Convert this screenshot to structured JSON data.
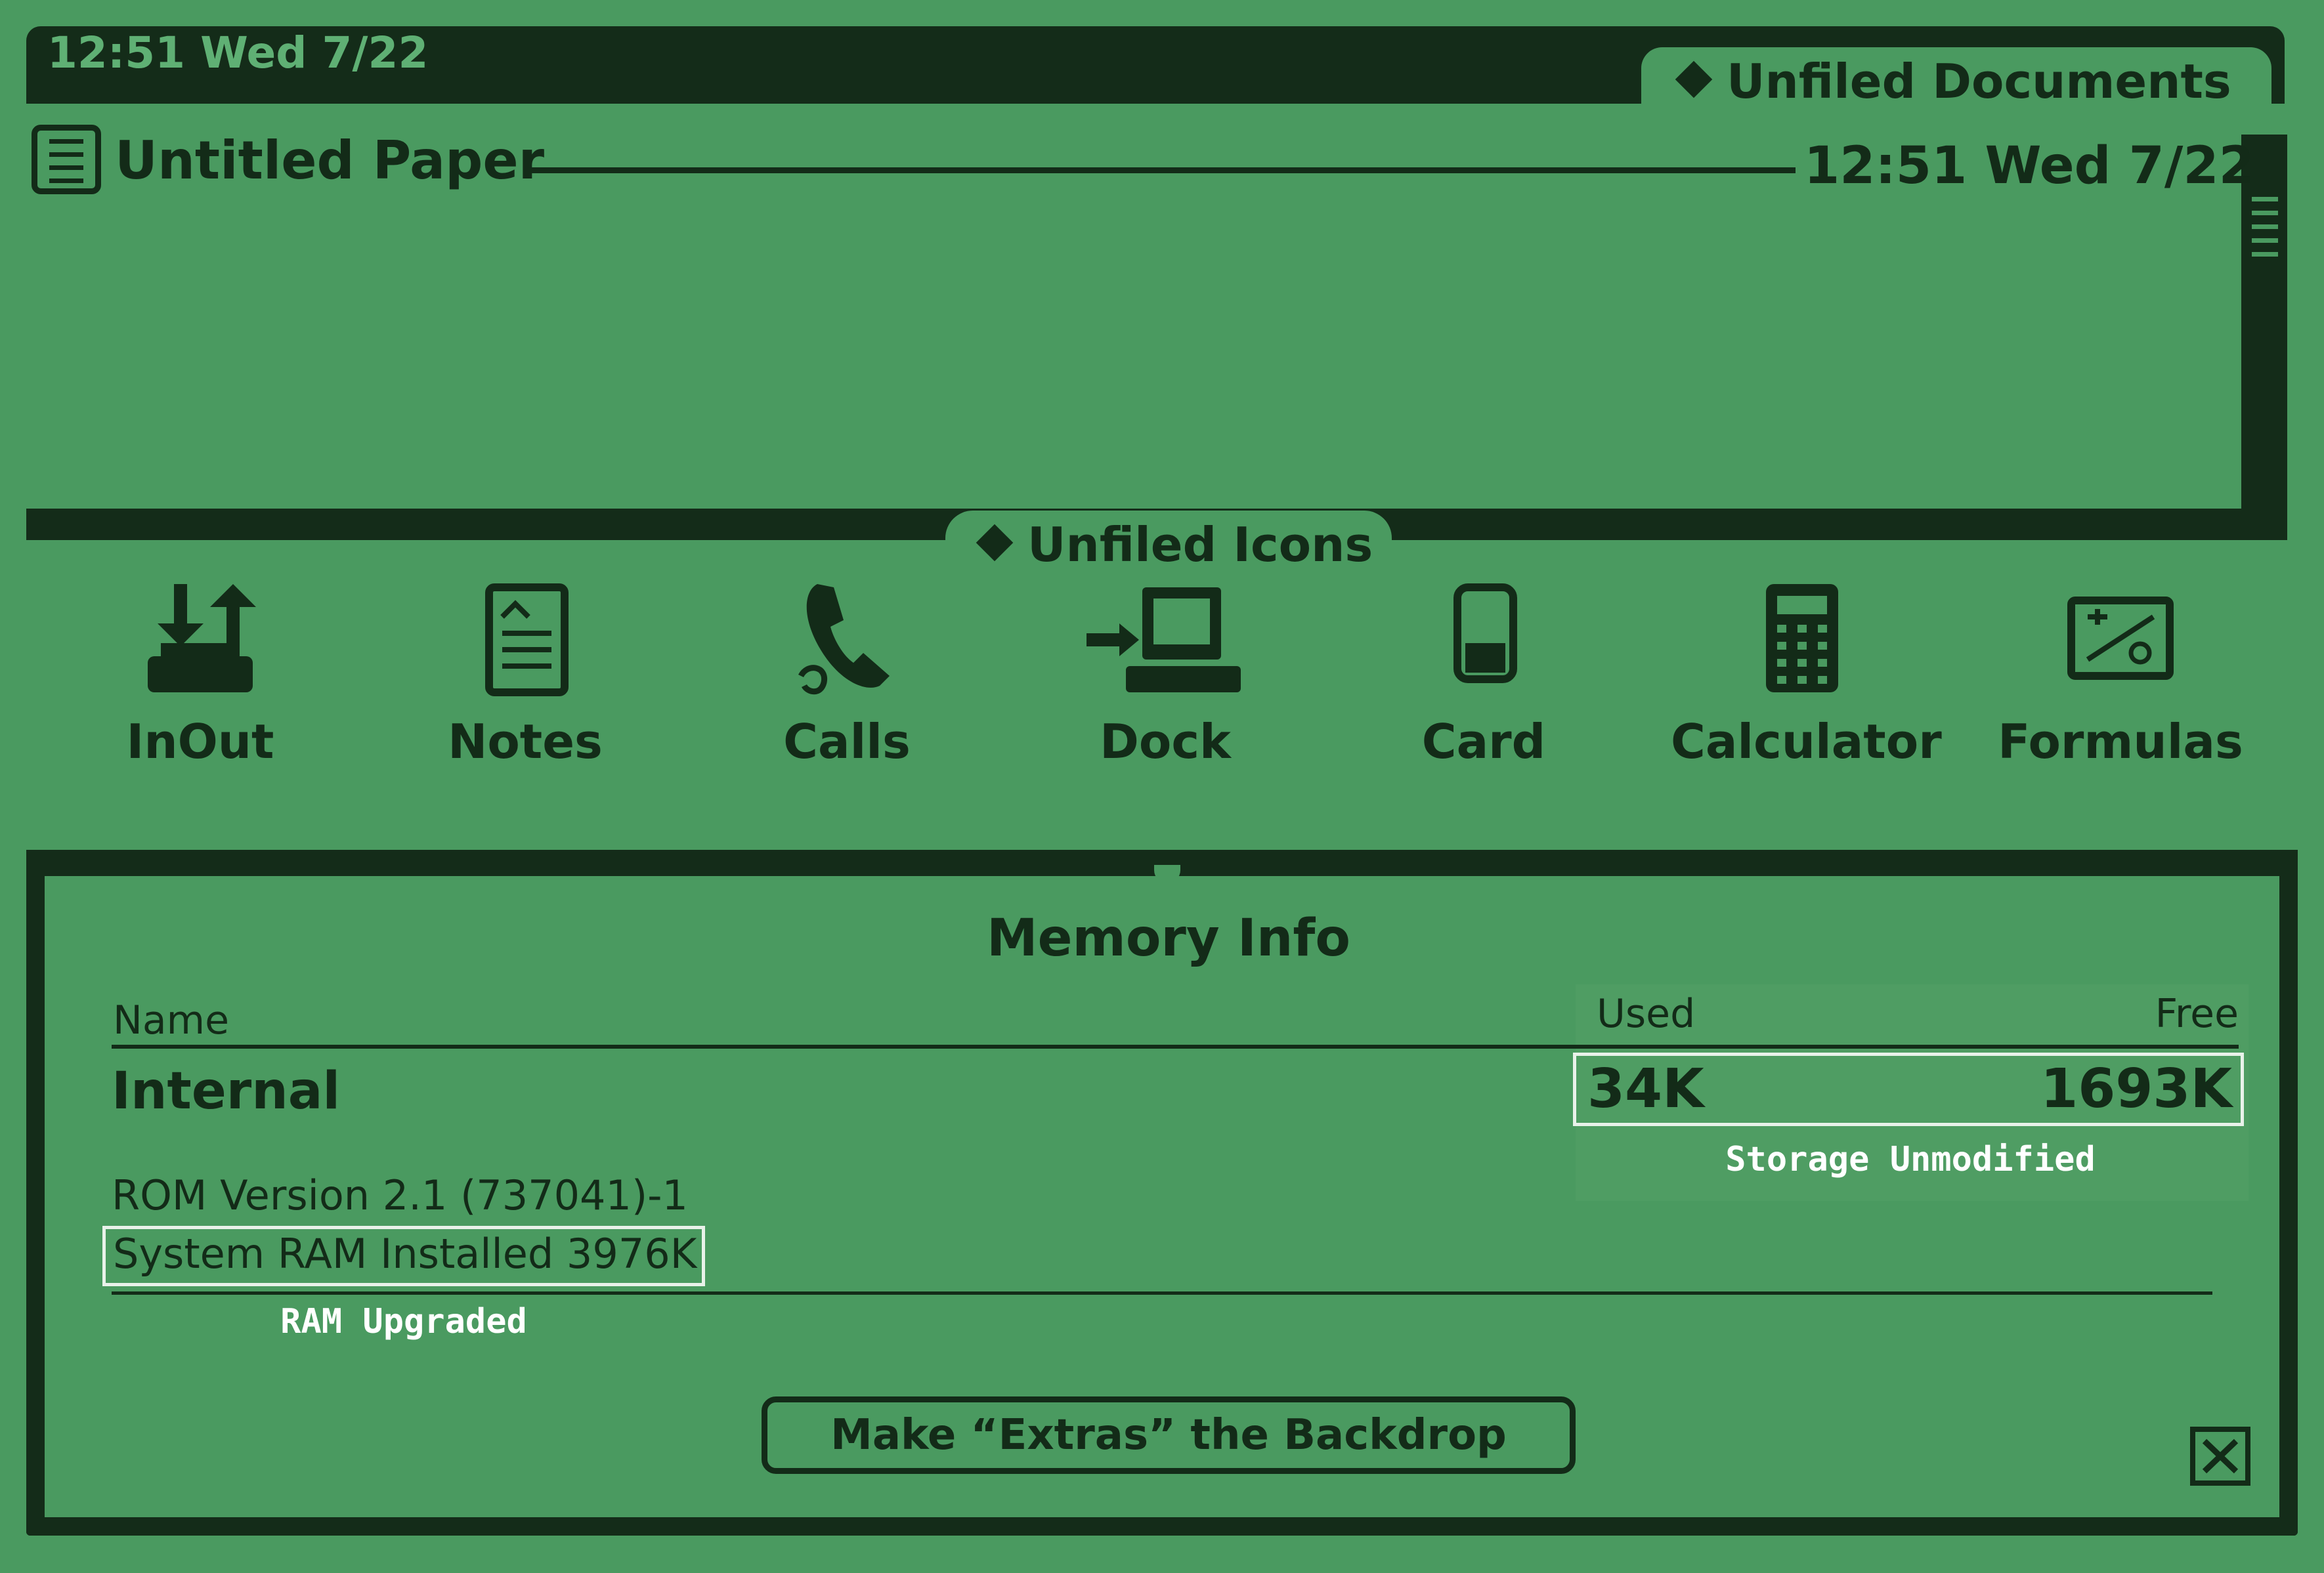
{
  "status_bar": {
    "time": "12:51 Wed 7/22"
  },
  "folder_docs": {
    "label": "Unfiled Documents"
  },
  "paper": {
    "title": "Untitled Paper",
    "date": "12:51 Wed 7/22"
  },
  "folder_icons": {
    "label": "Unfiled Icons"
  },
  "apps": [
    {
      "label": "InOut",
      "icon": "inout-icon"
    },
    {
      "label": "Notes",
      "icon": "notes-icon"
    },
    {
      "label": "Calls",
      "icon": "phone-icon"
    },
    {
      "label": "Dock",
      "icon": "dock-icon"
    },
    {
      "label": "Card",
      "icon": "card-icon"
    },
    {
      "label": "Calculator",
      "icon": "calculator-icon"
    },
    {
      "label": "Formulas",
      "icon": "formulas-icon"
    }
  ],
  "memory": {
    "title": "Memory Info",
    "headers": {
      "name": "Name",
      "used": "Used",
      "free": "Free"
    },
    "rows": [
      {
        "name": "Internal",
        "used": "34K",
        "free": "1693K"
      }
    ],
    "rom_version": "ROM Version 2.1 (737041)-1",
    "ram_installed": "System RAM Installed 3976K",
    "annotations": {
      "storage": "Storage Unmodified",
      "ram": "RAM Upgraded"
    },
    "button_label": "Make “Extras” the Backdrop"
  },
  "colors": {
    "screen": "#4a9a60",
    "ink": "#132b18",
    "annotation": "#ffffff"
  }
}
